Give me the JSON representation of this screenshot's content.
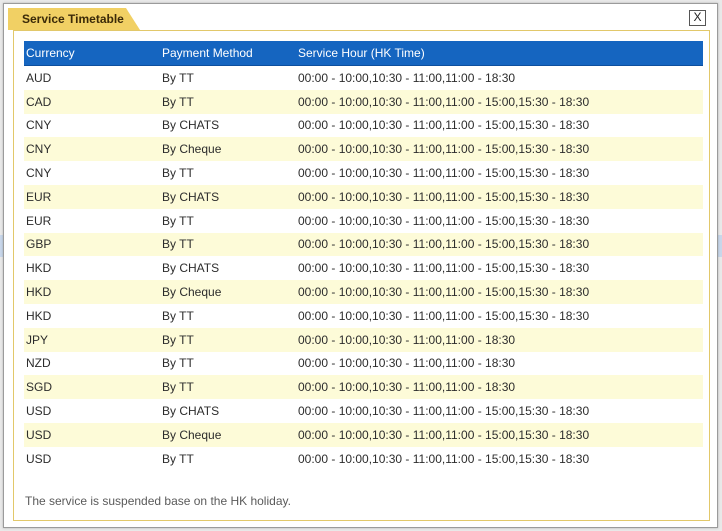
{
  "dialog": {
    "title": "Service Timetable",
    "close_label": "X"
  },
  "table": {
    "headers": [
      "Currency",
      "Payment Method",
      "Service Hour (HK Time)"
    ],
    "rows": [
      [
        "AUD",
        "By TT",
        "00:00 - 10:00,10:30 - 11:00,11:00 - 18:30"
      ],
      [
        "CAD",
        "By TT",
        "00:00 - 10:00,10:30 - 11:00,11:00 - 15:00,15:30 - 18:30"
      ],
      [
        "CNY",
        "By CHATS",
        "00:00 - 10:00,10:30 - 11:00,11:00 - 15:00,15:30 - 18:30"
      ],
      [
        "CNY",
        "By Cheque",
        "00:00 - 10:00,10:30 - 11:00,11:00 - 15:00,15:30 - 18:30"
      ],
      [
        "CNY",
        "By TT",
        "00:00 - 10:00,10:30 - 11:00,11:00 - 15:00,15:30 - 18:30"
      ],
      [
        "EUR",
        "By CHATS",
        "00:00 - 10:00,10:30 - 11:00,11:00 - 15:00,15:30 - 18:30"
      ],
      [
        "EUR",
        "By TT",
        "00:00 - 10:00,10:30 - 11:00,11:00 - 15:00,15:30 - 18:30"
      ],
      [
        "GBP",
        "By TT",
        "00:00 - 10:00,10:30 - 11:00,11:00 - 15:00,15:30 - 18:30"
      ],
      [
        "HKD",
        "By CHATS",
        "00:00 - 10:00,10:30 - 11:00,11:00 - 15:00,15:30 - 18:30"
      ],
      [
        "HKD",
        "By Cheque",
        "00:00 - 10:00,10:30 - 11:00,11:00 - 15:00,15:30 - 18:30"
      ],
      [
        "HKD",
        "By TT",
        "00:00 - 10:00,10:30 - 11:00,11:00 - 15:00,15:30 - 18:30"
      ],
      [
        "JPY",
        "By TT",
        "00:00 - 10:00,10:30 - 11:00,11:00 - 18:30"
      ],
      [
        "NZD",
        "By TT",
        "00:00 - 10:00,10:30 - 11:00,11:00 - 18:30"
      ],
      [
        "SGD",
        "By TT",
        "00:00 - 10:00,10:30 - 11:00,11:00 - 18:30"
      ],
      [
        "USD",
        "By CHATS",
        "00:00 - 10:00,10:30 - 11:00,11:00 - 15:00,15:30 - 18:30"
      ],
      [
        "USD",
        "By Cheque",
        "00:00 - 10:00,10:30 - 11:00,11:00 - 15:00,15:30 - 18:30"
      ],
      [
        "USD",
        "By TT",
        "00:00 - 10:00,10:30 - 11:00,11:00 - 15:00,15:30 - 18:30"
      ]
    ]
  },
  "footnote": "The service is suspended base on the HK holiday.",
  "colors": {
    "header_bg": "#1565c0",
    "title_tab": "#f1d064",
    "alt_row": "#fdfbd8"
  }
}
